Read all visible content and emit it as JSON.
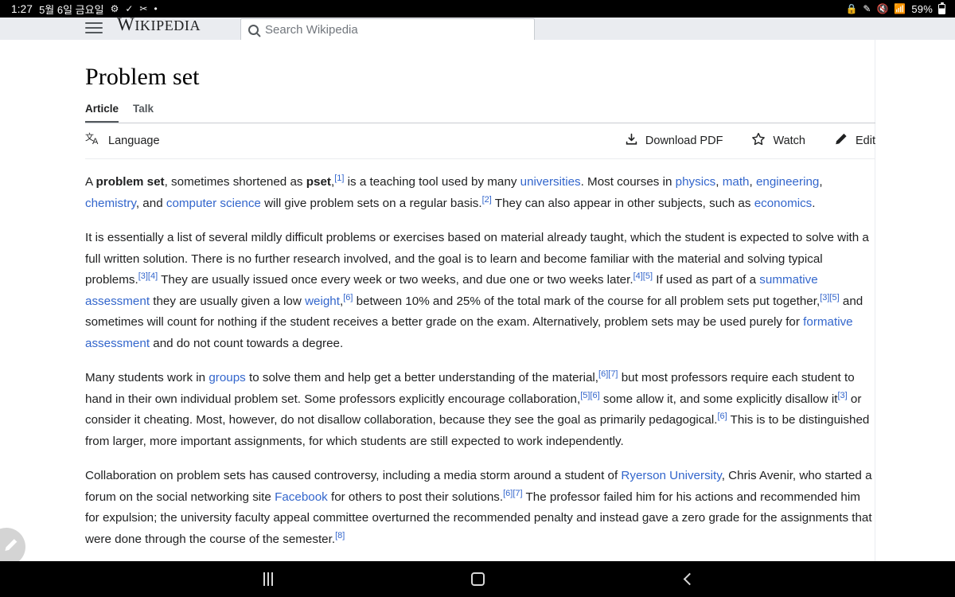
{
  "status_bar": {
    "clock": "1:27",
    "date": "5월 6일 금요일",
    "icons": [
      "gear-icon",
      "check-icon",
      "scissors-icon",
      "dot-icon"
    ],
    "right_icons": [
      "lock-icon",
      "pencil-icon",
      "volume-mute-icon",
      "wifi-icon"
    ],
    "battery_percent": "59%"
  },
  "browser_chrome": {
    "menu_icon": "hamburger-icon",
    "wordmark_w": "W",
    "wordmark_rest": "IKIPEDIA",
    "search_placeholder": "Search Wikipedia",
    "search_value": "",
    "search_icon": "search-icon"
  },
  "article": {
    "title": "Problem set",
    "tabs": [
      {
        "label": "Article",
        "active": true
      },
      {
        "label": "Talk",
        "active": false
      }
    ],
    "actions": {
      "language": "Language",
      "language_icon": "language-icon",
      "download_pdf": "Download PDF",
      "download_icon": "download-icon",
      "watch": "Watch",
      "watch_icon": "star-icon",
      "edit": "Edit",
      "edit_icon": "pencil-icon"
    },
    "paragraphs": [
      {
        "id": "p1",
        "runs": [
          {
            "t": "A ",
            "k": "text"
          },
          {
            "t": "problem set",
            "k": "bold"
          },
          {
            "t": ", sometimes shortened as ",
            "k": "text"
          },
          {
            "t": "pset",
            "k": "bold"
          },
          {
            "t": ",",
            "k": "text"
          },
          {
            "t": "[1]",
            "k": "ref"
          },
          {
            "t": " is a teaching tool used by many ",
            "k": "text"
          },
          {
            "t": "universities",
            "k": "link"
          },
          {
            "t": ". Most courses in ",
            "k": "text"
          },
          {
            "t": "physics",
            "k": "link"
          },
          {
            "t": ", ",
            "k": "text"
          },
          {
            "t": "math",
            "k": "link"
          },
          {
            "t": ", ",
            "k": "text"
          },
          {
            "t": "engineering",
            "k": "link"
          },
          {
            "t": ", ",
            "k": "text"
          },
          {
            "t": "chemistry",
            "k": "link"
          },
          {
            "t": ", and ",
            "k": "text"
          },
          {
            "t": "computer science",
            "k": "link"
          },
          {
            "t": " will give problem sets on a regular basis.",
            "k": "text"
          },
          {
            "t": "[2]",
            "k": "ref"
          },
          {
            "t": " They can also appear in other subjects, such as ",
            "k": "text"
          },
          {
            "t": "economics",
            "k": "link"
          },
          {
            "t": ".",
            "k": "text"
          }
        ]
      },
      {
        "id": "p2",
        "runs": [
          {
            "t": "It is essentially a list of several mildly difficult problems or exercises based on material already taught, which the student is expected to solve with a full written solution. There is no further research involved, and the goal is to learn and become familiar with the material and solving typical problems.",
            "k": "text"
          },
          {
            "t": "[3][4]",
            "k": "ref"
          },
          {
            "t": " They are usually issued once every week or two weeks, and due one or two weeks later.",
            "k": "text"
          },
          {
            "t": "[4][5]",
            "k": "ref"
          },
          {
            "t": " If used as part of a ",
            "k": "text"
          },
          {
            "t": "summative assessment",
            "k": "link"
          },
          {
            "t": " they are usually given a low ",
            "k": "text"
          },
          {
            "t": "weight",
            "k": "link"
          },
          {
            "t": ",",
            "k": "text"
          },
          {
            "t": "[6]",
            "k": "ref"
          },
          {
            "t": " between 10% and 25% of the total mark of the course for all problem sets put together,",
            "k": "text"
          },
          {
            "t": "[3][5]",
            "k": "ref"
          },
          {
            "t": " and sometimes will count for nothing if the student receives a better grade on the exam. Alternatively, problem sets may be used purely for ",
            "k": "text"
          },
          {
            "t": "formative assessment",
            "k": "link"
          },
          {
            "t": " and do not count towards a degree.",
            "k": "text"
          }
        ]
      },
      {
        "id": "p3",
        "runs": [
          {
            "t": "Many students work in ",
            "k": "text"
          },
          {
            "t": "groups",
            "k": "link"
          },
          {
            "t": " to solve them and help get a better understanding of the material,",
            "k": "text"
          },
          {
            "t": "[6][7]",
            "k": "ref"
          },
          {
            "t": " but most professors require each student to hand in their own individual problem set. Some professors explicitly encourage collaboration,",
            "k": "text"
          },
          {
            "t": "[5][6]",
            "k": "ref"
          },
          {
            "t": " some allow it, and some explicitly disallow it",
            "k": "text"
          },
          {
            "t": "[3]",
            "k": "ref"
          },
          {
            "t": " or consider it cheating. Most, however, do not disallow collaboration, because they see the goal as primarily pedagogical.",
            "k": "text"
          },
          {
            "t": "[6]",
            "k": "ref"
          },
          {
            "t": " This is to be distinguished from larger, more important assignments, for which students are still expected to work independently.",
            "k": "text"
          }
        ]
      },
      {
        "id": "p4",
        "runs": [
          {
            "t": "Collaboration on problem sets has caused controversy, including a media storm around a student of ",
            "k": "text"
          },
          {
            "t": "Ryerson University",
            "k": "link"
          },
          {
            "t": ", Chris Avenir, who started a forum on the social networking site ",
            "k": "text"
          },
          {
            "t": "Facebook",
            "k": "link"
          },
          {
            "t": " for others to post their solutions.",
            "k": "text"
          },
          {
            "t": "[6][7]",
            "k": "ref"
          },
          {
            "t": " The professor failed him for his actions and recommended him for expulsion; the university faculty appeal committee overturned the recommended penalty and instead gave a zero grade for the assignments that were done through the course of the semester.",
            "k": "text"
          },
          {
            "t": "[8]",
            "k": "ref"
          }
        ]
      }
    ]
  },
  "fab": {
    "icon": "pencil-icon"
  },
  "nav_bar": {
    "recents": "recents-icon",
    "home": "home-icon",
    "back": "back-icon"
  },
  "colors": {
    "link": "#3366cc",
    "chrome_bg": "#eaecf0",
    "text": "#202122",
    "system_bar": "#000000"
  }
}
